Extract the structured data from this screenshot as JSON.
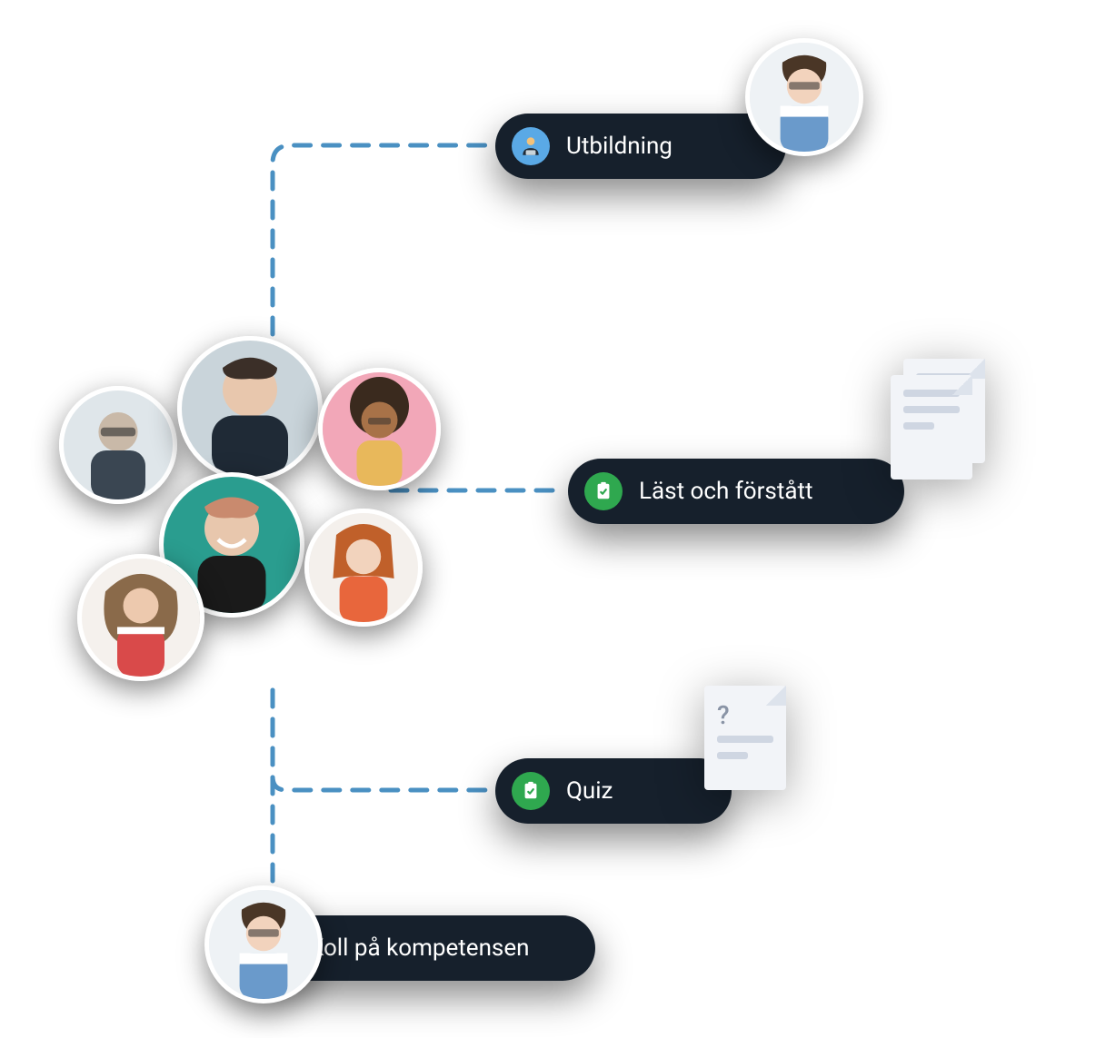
{
  "pills": {
    "training": {
      "label": "Utbildning",
      "icon": "person-laptop-icon",
      "iconColor": "#5aa9e6"
    },
    "readUnderstood": {
      "label": "Läst och förstått",
      "icon": "clipboard-check-icon",
      "iconColor": "#2fa84f"
    },
    "quiz": {
      "label": "Quiz",
      "icon": "clipboard-check-icon",
      "iconColor": "#2fa84f"
    },
    "competence": {
      "label": "Koll på kompetensen",
      "icon": "none"
    }
  },
  "quizDoc": {
    "symbol": "?"
  },
  "avatars": {
    "cluster": [
      {
        "id": "person-1"
      },
      {
        "id": "person-2"
      },
      {
        "id": "person-3"
      },
      {
        "id": "person-4"
      },
      {
        "id": "person-5"
      },
      {
        "id": "person-6"
      }
    ],
    "training": {
      "id": "person-training"
    },
    "competence": {
      "id": "person-competence"
    }
  },
  "colors": {
    "pillBg": "#16202c",
    "connector": "#4a90c2",
    "iconBlue": "#5aa9e6",
    "iconGreen": "#2fa84f"
  }
}
